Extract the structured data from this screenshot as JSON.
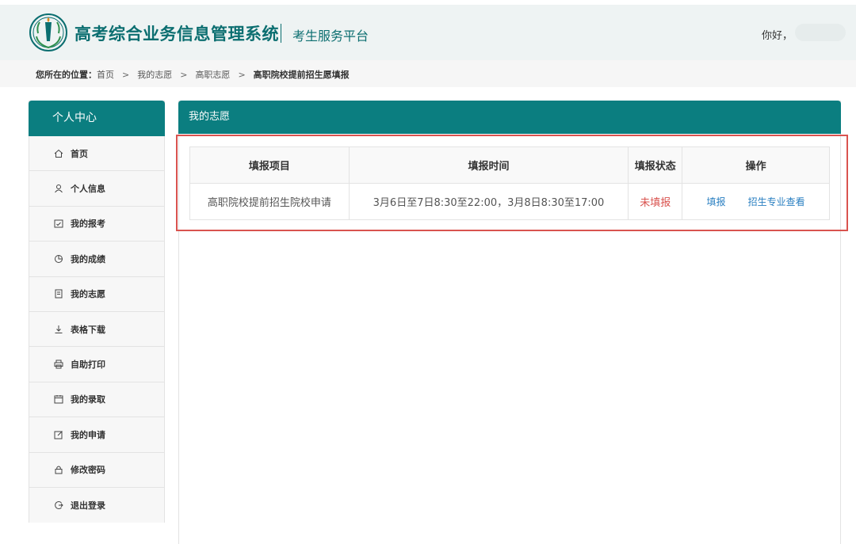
{
  "header": {
    "title": "高考综合业务信息管理系统",
    "subtitle": "考生服务平台",
    "greeting": "你好，"
  },
  "breadcrumb": {
    "lead": "您所在的位置：",
    "items": [
      "首页",
      "我的志愿",
      "高职志愿"
    ],
    "current": "高职院校提前招生愿填报",
    "separator": ">"
  },
  "sidebar": {
    "title": "个人中心",
    "items": [
      {
        "label": "首页",
        "icon": "home-icon"
      },
      {
        "label": "个人信息",
        "icon": "user-icon"
      },
      {
        "label": "我的报考",
        "icon": "calendar-check-icon"
      },
      {
        "label": "我的成绩",
        "icon": "pie-chart-icon"
      },
      {
        "label": "我的志愿",
        "icon": "document-icon"
      },
      {
        "label": "表格下载",
        "icon": "download-icon"
      },
      {
        "label": "自助打印",
        "icon": "printer-icon"
      },
      {
        "label": "我的录取",
        "icon": "calendar-icon"
      },
      {
        "label": "我的申请",
        "icon": "edit-icon"
      },
      {
        "label": "修改密码",
        "icon": "lock-icon"
      },
      {
        "label": "退出登录",
        "icon": "logout-icon"
      }
    ]
  },
  "panel": {
    "title": "我的志愿"
  },
  "table": {
    "headers": [
      "填报项目",
      "填报时间",
      "填报状态",
      "操作"
    ],
    "rows": [
      {
        "project": "高职院校提前招生院校申请",
        "time": "3月6日至7日8:30至22:00，3月8日8:30至17:00",
        "status": "未填报",
        "actions": [
          "填报",
          "招生专业查看"
        ]
      }
    ]
  },
  "colors": {
    "brand": "#0b7e80",
    "status_red": "#d9534f",
    "link_blue": "#2a7fc1"
  }
}
